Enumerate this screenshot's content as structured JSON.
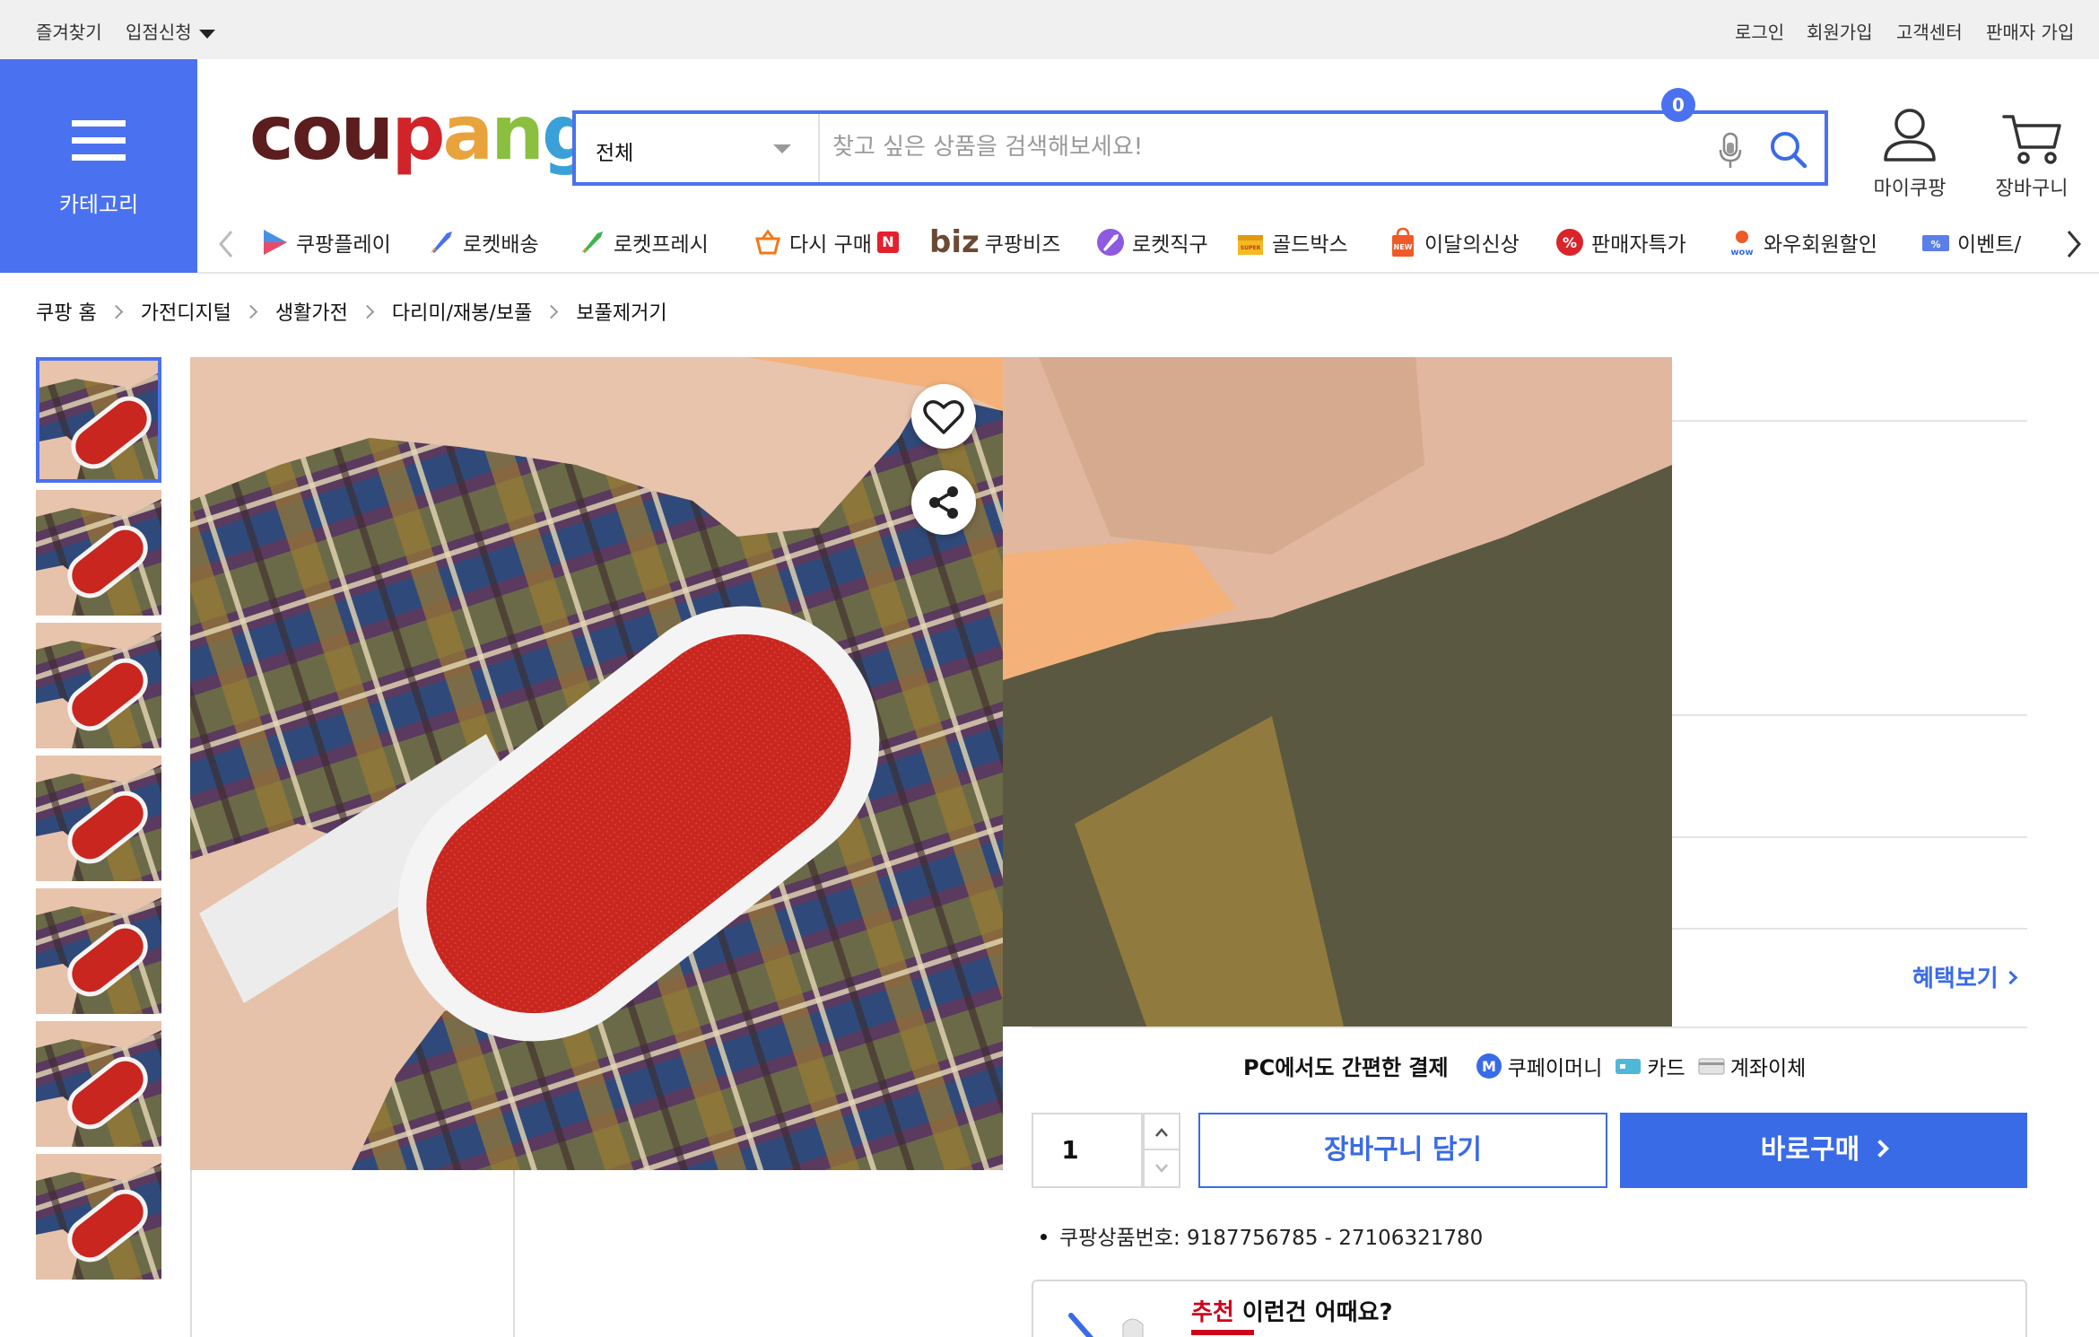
{
  "topbar": {
    "bookmark": "즐겨찾기",
    "seller_apply": "입점신청",
    "login": "로그인",
    "signup": "회원가입",
    "customer_center": "고객센터",
    "seller_signup": "판매자 가입"
  },
  "header": {
    "category_label": "카테고리",
    "logo_letters": [
      "c",
      "o",
      "u",
      "p",
      "a",
      "n",
      "g"
    ],
    "logo_colors": [
      "#5b1d1d",
      "#5b1d1d",
      "#5b1d1d",
      "#d1232a",
      "#e8a33c",
      "#8bbf3f",
      "#3aa0d8"
    ],
    "search_scope": "전체",
    "search_placeholder": "찾고 싶은 상품을 검색해보세요!",
    "my_coupang": "마이쿠팡",
    "cart": "장바구니",
    "cart_count": "0"
  },
  "shortcuts": [
    {
      "label": "쿠팡플레이",
      "icon": "coupang-play-icon"
    },
    {
      "label": "로켓배송",
      "icon": "rocket-icon"
    },
    {
      "label": "로켓프레시",
      "icon": "rocket-fresh-icon"
    },
    {
      "label": "다시 구매",
      "icon": "rebuy-basket-icon",
      "badge": "N"
    },
    {
      "label": "쿠팡비즈",
      "icon": "biz-icon",
      "prefix": "biz"
    },
    {
      "label": "로켓직구",
      "icon": "rocket-global-icon"
    },
    {
      "label": "골드박스",
      "icon": "goldbox-icon"
    },
    {
      "label": "이달의신상",
      "icon": "new-bag-icon"
    },
    {
      "label": "판매자특가",
      "icon": "seller-deal-icon"
    },
    {
      "label": "와우회원할인",
      "icon": "wow-icon"
    },
    {
      "label": "이벤트/",
      "icon": "event-coupon-icon"
    }
  ],
  "breadcrumb": [
    "쿠팡 홈",
    "가전디지털",
    "생활가전",
    "다리미/재봉/보풀",
    "보풀제거기"
  ],
  "product": {
    "benefit_link": "혜택보기",
    "pay_title": "PC에서도 간편한 결제",
    "pay_options": [
      "쿠페이머니",
      "카드",
      "계좌이체"
    ],
    "quantity": "1",
    "add_to_cart": "장바구니 담기",
    "buy_now": "바로구매",
    "product_number": "쿠팡상품번호: 9187756785 - 27106321780"
  },
  "recommend": {
    "highlight": "추천",
    "title": " 이런건 어때요?"
  },
  "colors": {
    "accent": "#4a71ef",
    "brand_red": "#d0021b",
    "lint_pad": "#c8261f"
  }
}
